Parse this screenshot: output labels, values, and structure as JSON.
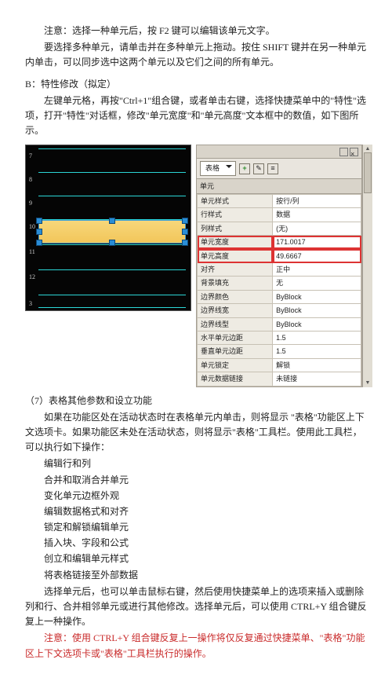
{
  "para": {
    "note1": "注意：选择一种单元后，按 F2 键可以编辑该单元文字。",
    "multi": "要选择多种单元，请单击并在多种单元上拖动。按住 SHIFT 键并在另一种单元内单击，可以同步选中这两个单元以及它们之间的所有单元。",
    "b_title": "B：特性修改（拟定）",
    "b_body": "左键单元格，再按\"Ctrl+1\"组合键，或者单击右键，选择快捷菜单中的\"特性\"选项，打开\"特性\"对话框，修改\"单元宽度\"和\"单元高度\"文本框中的数值，如下图所示。",
    "s7_title": "（7）表格其他参数和设立功能",
    "s7_body": "如果在功能区处在活动状态时在表格单元内单击，则将显示 \"表格\"功能区上下文选项卡。如果功能区未处在活动状态，则将显示\"表格\"工具栏。使用此工具栏，可以执行如下操作：",
    "after1": "选择单元后，也可以单击鼠标右键，然后使用快捷菜单上的选项来插入或删除列和行、合并相邻单元或进行其他修改。选择单元后，可以使用 CTRL+Y 组合键反复上一种操作。",
    "after2_red": "注意：使用 CTRL+Y 组合键反复上一操作将仅反复通过快捷菜单、\"表格\"功能区上下文选项卡或\"表格\"工具栏执行的操作。"
  },
  "ops": [
    "编辑行和列",
    "合并和取消合并单元",
    "变化单元边框外观",
    "编辑数据格式和对齐",
    "锁定和解锁编辑单元",
    "插入块、字段和公式",
    "创立和编辑单元样式",
    "将表格链接至外部数据"
  ],
  "ticks": [
    "7",
    "8",
    "9",
    "10",
    "11",
    "12",
    "3"
  ],
  "panel": {
    "tab": "表格",
    "sub": "单元",
    "rows": [
      {
        "k": "单元样式",
        "v": "按行/列"
      },
      {
        "k": "行样式",
        "v": "数据"
      },
      {
        "k": "列样式",
        "v": "(无)"
      },
      {
        "k": "单元宽度",
        "v": "171.0017",
        "hl": true
      },
      {
        "k": "单元高度",
        "v": "49.6667",
        "hl": true
      },
      {
        "k": "对齐",
        "v": "正中"
      },
      {
        "k": "背景填充",
        "v": "无"
      },
      {
        "k": "边界颜色",
        "v": "ByBlock"
      },
      {
        "k": "边界线宽",
        "v": "ByBlock"
      },
      {
        "k": "边界线型",
        "v": "ByBlock"
      },
      {
        "k": "水平单元边距",
        "v": "1.5"
      },
      {
        "k": "垂直单元边距",
        "v": "1.5"
      },
      {
        "k": "单元锁定",
        "v": "解锁"
      },
      {
        "k": "单元数据链接",
        "v": "未链接"
      }
    ]
  }
}
